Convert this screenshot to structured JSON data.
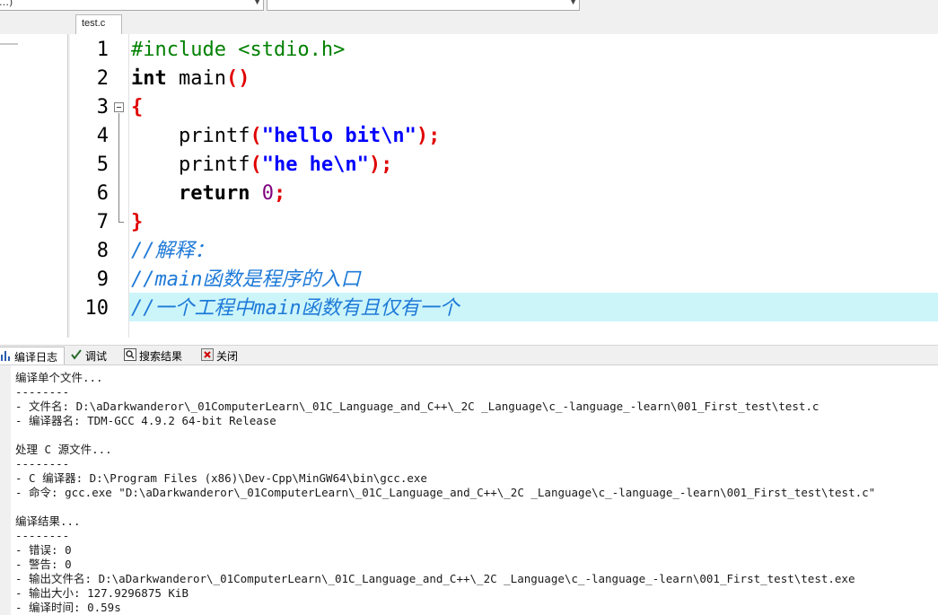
{
  "toolbar": {
    "combo1_text": "…)",
    "combo2_text": ""
  },
  "editor": {
    "tab_label": "test.c",
    "line_numbers": [
      "1",
      "2",
      "3",
      "4",
      "5",
      "6",
      "7",
      "8",
      "9",
      "10"
    ],
    "code": {
      "l1": "#include <stdio.h>",
      "l2_kw": "int",
      "l2_fn": " main",
      "l2_paren": "()",
      "l3": "{",
      "l4_fn": "    printf",
      "l4_open": "(",
      "l4_str": "\"hello bit\\n\"",
      "l4_close": ");",
      "l5_fn": "    printf",
      "l5_open": "(",
      "l5_str": "\"he he\\n\"",
      "l5_close": ");",
      "l6_kw": "    return",
      "l6_num": " 0",
      "l6_semi": ";",
      "l7": "}",
      "l8": "//解释：",
      "l9": "//main函数是程序的入口",
      "l10": "//一个工程中main函数有且仅有一个"
    }
  },
  "bottom_tabs": {
    "compile_log": "编译日志",
    "debug": "调试",
    "search_results": "搜索结果",
    "close": "关闭"
  },
  "log_lines": [
    "编译单个文件...",
    "--------",
    "- 文件名: D:\\aDarkwanderor\\_01ComputerLearn\\_01C_Language_and_C++\\_2C _Language\\c_-language_-learn\\001_First_test\\test.c",
    "- 编译器名: TDM-GCC 4.9.2 64-bit Release",
    "",
    "处理 C 源文件...",
    "--------",
    "- C 编译器: D:\\Program Files (x86)\\Dev-Cpp\\MinGW64\\bin\\gcc.exe",
    "- 命令: gcc.exe \"D:\\aDarkwanderor\\_01ComputerLearn\\_01C_Language_and_C++\\_2C _Language\\c_-language_-learn\\001_First_test\\test.c\"",
    "",
    "编译结果...",
    "--------",
    "- 错误: 0",
    "- 警告: 0",
    "- 输出文件名: D:\\aDarkwanderor\\_01ComputerLearn\\_01C_Language_and_C++\\_2C _Language\\c_-language_-learn\\001_First_test\\test.exe",
    "- 输出大小: 127.9296875 KiB",
    "- 编译时间: 0.59s"
  ]
}
